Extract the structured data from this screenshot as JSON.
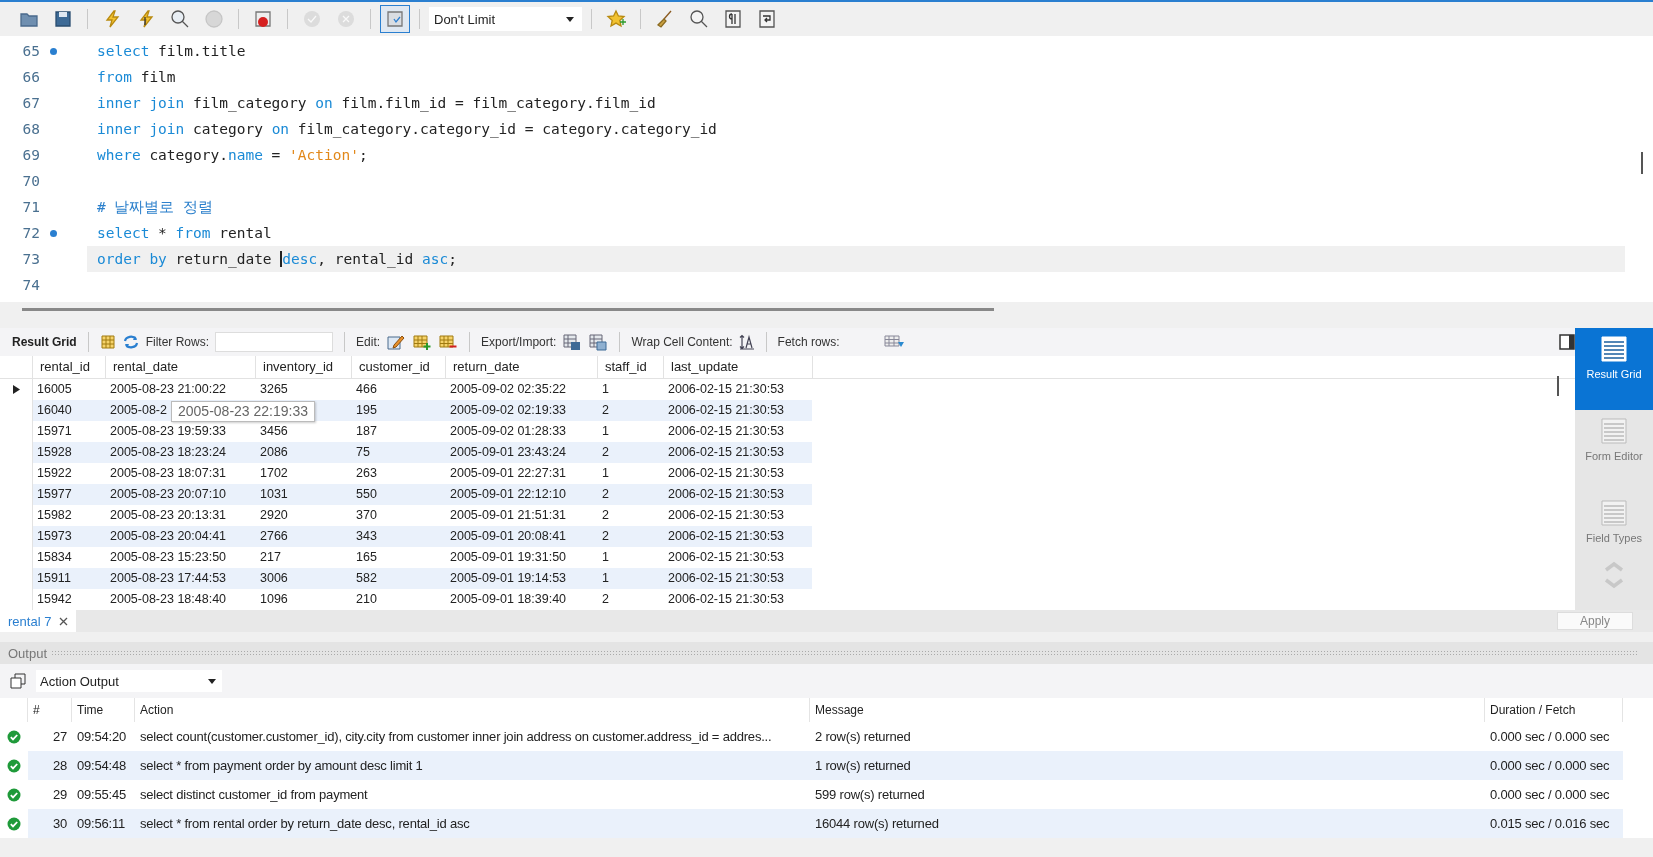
{
  "toolbar": {
    "buttons": [
      {
        "disabled": false,
        "pressed": false
      },
      {
        "disabled": false,
        "pressed": false
      },
      {
        "disabled": false,
        "pressed": false
      },
      {
        "disabled": false,
        "pressed": false
      },
      {
        "disabled": false,
        "pressed": false
      },
      {
        "disabled": true,
        "pressed": false
      },
      {
        "disabled": false,
        "pressed": false
      },
      {
        "disabled": true,
        "pressed": false
      },
      {
        "disabled": true,
        "pressed": false
      },
      {
        "disabled": false,
        "pressed": true
      }
    ],
    "limit": "Don't Limit",
    "after": [
      {
        "disabled": false
      },
      {
        "disabled": false
      },
      {
        "disabled": false
      },
      {
        "disabled": false
      },
      {
        "disabled": false
      }
    ]
  },
  "editor": {
    "lines": [
      {
        "number": "65",
        "marker": true,
        "current": false,
        "tokens": [
          {
            "kind": "keyword",
            "text": "select"
          },
          {
            "kind": "plain",
            "text": " film.title"
          }
        ]
      },
      {
        "number": "66",
        "marker": false,
        "current": false,
        "tokens": [
          {
            "kind": "keyword",
            "text": "from"
          },
          {
            "kind": "plain",
            "text": " film"
          }
        ]
      },
      {
        "number": "67",
        "marker": false,
        "current": false,
        "tokens": [
          {
            "kind": "keyword",
            "text": "inner join"
          },
          {
            "kind": "plain",
            "text": " film_category "
          },
          {
            "kind": "keyword",
            "text": "on"
          },
          {
            "kind": "plain",
            "text": " film.film_id = film_category.film_id"
          }
        ]
      },
      {
        "number": "68",
        "marker": false,
        "current": false,
        "tokens": [
          {
            "kind": "keyword",
            "text": "inner join"
          },
          {
            "kind": "plain",
            "text": " category "
          },
          {
            "kind": "keyword",
            "text": "on"
          },
          {
            "kind": "plain",
            "text": " film_category.category_id = category.category_id"
          }
        ]
      },
      {
        "number": "69",
        "marker": false,
        "current": false,
        "tokens": [
          {
            "kind": "keyword",
            "text": "where"
          },
          {
            "kind": "plain",
            "text": " category."
          },
          {
            "kind": "keyword",
            "text": "name"
          },
          {
            "kind": "plain",
            "text": " = "
          },
          {
            "kind": "string",
            "text": "'Action'"
          },
          {
            "kind": "plain",
            "text": ";"
          }
        ]
      },
      {
        "number": "70",
        "marker": false,
        "current": false
      },
      {
        "number": "71",
        "marker": false,
        "current": false,
        "tokens": [
          {
            "kind": "comment",
            "text": "# 날짜별로 정렬"
          }
        ]
      },
      {
        "number": "72",
        "marker": true,
        "current": false,
        "tokens": [
          {
            "kind": "keyword",
            "text": "select"
          },
          {
            "kind": "plain",
            "text": " * "
          },
          {
            "kind": "keyword",
            "text": "from"
          },
          {
            "kind": "plain",
            "text": " rental"
          }
        ]
      },
      {
        "number": "73",
        "marker": false,
        "current": true,
        "tokens": [
          {
            "kind": "keyword",
            "text": "order by"
          },
          {
            "kind": "plain",
            "text": " return_date "
          },
          {
            "kind": "keyword",
            "text": "desc",
            "caret": true
          },
          {
            "kind": "plain",
            "text": ", rental_id "
          },
          {
            "kind": "keyword",
            "text": "asc"
          },
          {
            "kind": "plain",
            "text": ";"
          }
        ]
      },
      {
        "number": "74",
        "marker": false,
        "current": false
      }
    ]
  },
  "result_toolbar": {
    "title": "Result Grid",
    "filter_label": "Filter Rows:",
    "edit_label": "Edit:",
    "export_label": "Export/Import:",
    "wrap_label": "Wrap Cell Content:",
    "fetch_label": "Fetch rows:"
  },
  "grid": {
    "columns": [
      "rental_id",
      "rental_date",
      "inventory_id",
      "customer_id",
      "return_date",
      "staff_id",
      "last_update"
    ],
    "rows": [
      {
        "selected": true,
        "cells": [
          "16005",
          "2005-08-23 21:00:22",
          "3265",
          "466",
          "2005-09-02 02:35:22",
          "1",
          "2006-02-15 21:30:53"
        ]
      },
      {
        "selected": false,
        "cells": [
          "16040",
          "2005-08-2",
          null,
          "195",
          "2005-09-02 02:19:33",
          "2",
          "2006-02-15 21:30:53"
        ]
      },
      {
        "selected": false,
        "cells": [
          "15971",
          "2005-08-23 19:59:33",
          "3456",
          "187",
          "2005-09-02 01:28:33",
          "1",
          "2006-02-15 21:30:53"
        ]
      },
      {
        "selected": false,
        "cells": [
          "15928",
          "2005-08-23 18:23:24",
          "2086",
          "75",
          "2005-09-01 23:43:24",
          "2",
          "2006-02-15 21:30:53"
        ]
      },
      {
        "selected": false,
        "cells": [
          "15922",
          "2005-08-23 18:07:31",
          "1702",
          "263",
          "2005-09-01 22:27:31",
          "1",
          "2006-02-15 21:30:53"
        ]
      },
      {
        "selected": false,
        "cells": [
          "15977",
          "2005-08-23 20:07:10",
          "1031",
          "550",
          "2005-09-01 22:12:10",
          "2",
          "2006-02-15 21:30:53"
        ]
      },
      {
        "selected": false,
        "cells": [
          "15982",
          "2005-08-23 20:13:31",
          "2920",
          "370",
          "2005-09-01 21:51:31",
          "2",
          "2006-02-15 21:30:53"
        ]
      },
      {
        "selected": false,
        "cells": [
          "15973",
          "2005-08-23 20:04:41",
          "2766",
          "343",
          "2005-09-01 20:08:41",
          "2",
          "2006-02-15 21:30:53"
        ]
      },
      {
        "selected": false,
        "cells": [
          "15834",
          "2005-08-23 15:23:50",
          "217",
          "165",
          "2005-09-01 19:31:50",
          "1",
          "2006-02-15 21:30:53"
        ]
      },
      {
        "selected": false,
        "cells": [
          "15911",
          "2005-08-23 17:44:53",
          "3006",
          "582",
          "2005-09-01 19:14:53",
          "1",
          "2006-02-15 21:30:53"
        ]
      },
      {
        "selected": false,
        "cells": [
          "15942",
          "2005-08-23 18:48:40",
          "1096",
          "210",
          "2005-09-01 18:39:40",
          "2",
          "2006-02-15 21:30:53"
        ]
      }
    ],
    "tooltip": "2005-08-23 22:19:33"
  },
  "side_panel": [
    {
      "label": "Result Grid",
      "selected": true
    },
    {
      "label": "Form Editor",
      "selected": false
    },
    {
      "label": "Field Types",
      "selected": false
    }
  ],
  "result_tab": {
    "label": "rental 7",
    "apply": "Apply"
  },
  "output": {
    "title": "Output",
    "selector": "Action Output",
    "columns": [
      "#",
      "Time",
      "Action",
      "Message",
      "Duration / Fetch"
    ],
    "rows": [
      {
        "selected": false,
        "number": "27",
        "time": "09:54:20",
        "action": "select count(customer.customer_id), city.city from customer inner join address on customer.address_id = addres...",
        "message": "2 row(s) returned",
        "duration": "0.000 sec / 0.000 sec"
      },
      {
        "selected": true,
        "number": "28",
        "time": "09:54:48",
        "action": "select * from payment order by amount desc limit 1",
        "message": "1 row(s) returned",
        "duration": "0.000 sec / 0.000 sec"
      },
      {
        "selected": false,
        "number": "29",
        "time": "09:55:45",
        "action": "select distinct customer_id from payment",
        "message": "599 row(s) returned",
        "duration": "0.000 sec / 0.000 sec"
      },
      {
        "selected": true,
        "number": "30",
        "time": "09:56:11",
        "action": "select * from rental order by return_date desc, rental_id asc",
        "message": "16044 row(s) returned",
        "duration": "0.015 sec / 0.016 sec"
      }
    ]
  }
}
